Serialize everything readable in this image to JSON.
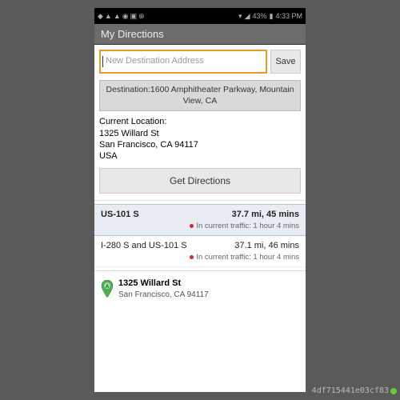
{
  "status": {
    "battery": "43%",
    "time": "4:33 PM"
  },
  "header": {
    "title": "My Directions"
  },
  "input": {
    "placeholder": "New Destination Address",
    "save_label": "Save"
  },
  "destination": {
    "label": "Destination:1600 Amphitheater Parkway, Mountain View, CA"
  },
  "current_location": {
    "label": "Current Location:",
    "line1": "1325 Willard St",
    "line2": "San Francisco, CA 94117",
    "line3": "USA"
  },
  "actions": {
    "get_directions": "Get Directions"
  },
  "routes": [
    {
      "name": "US-101 S",
      "summary": "37.7 mi, 45 mins",
      "traffic": "In current traffic: 1 hour 4 mins"
    },
    {
      "name": "I-280 S and US-101 S",
      "summary": "37.1 mi, 46 mins",
      "traffic": "In current traffic: 1 hour 4 mins"
    }
  ],
  "origin": {
    "title": "1325 Willard St",
    "sub": "San Francisco, CA 94117"
  },
  "device_id": "4df715441e03cf83"
}
